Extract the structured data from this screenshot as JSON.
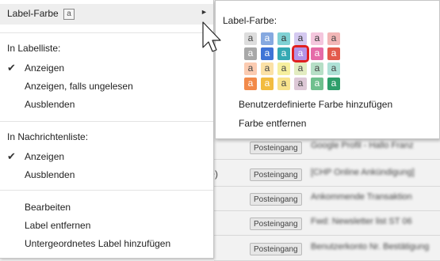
{
  "menu": {
    "label_color": {
      "label": "Label-Farbe",
      "badge": "a",
      "arrow": "►"
    },
    "in_label_list": {
      "header": "In Labelliste:",
      "items": [
        {
          "label": "Anzeigen",
          "checked": true
        },
        {
          "label": "Anzeigen, falls ungelesen",
          "checked": false
        },
        {
          "label": "Ausblenden",
          "checked": false
        }
      ]
    },
    "in_message_list": {
      "header": "In Nachrichtenliste:",
      "items": [
        {
          "label": "Anzeigen",
          "checked": true
        },
        {
          "label": "Ausblenden",
          "checked": false
        }
      ]
    },
    "actions": [
      {
        "label": "Bearbeiten"
      },
      {
        "label": "Label entfernen"
      },
      {
        "label": "Untergeordnetes Label hinzufügen"
      }
    ],
    "checkmark": "✔"
  },
  "color_submenu": {
    "title": "Label-Farbe:",
    "swatch_letter": "a",
    "grid": [
      [
        {
          "bg": "#dddddd",
          "fg": "#444444"
        },
        {
          "bg": "#86a9e0",
          "fg": "#ffffff"
        },
        {
          "bg": "#7fd1d4",
          "fg": "#333333"
        },
        {
          "bg": "#d4c9f0",
          "fg": "#333333"
        },
        {
          "bg": "#f4c6dd",
          "fg": "#333333"
        },
        {
          "bg": "#f2b6b6",
          "fg": "#444444"
        }
      ],
      [
        {
          "bg": "#a8a8a8",
          "fg": "#ffffff"
        },
        {
          "bg": "#3f74d6",
          "fg": "#ffffff"
        },
        {
          "bg": "#35a9b3",
          "fg": "#ffffff"
        },
        {
          "bg": "#b493e6",
          "fg": "#ffffff",
          "selected": true
        },
        {
          "bg": "#e56ba8",
          "fg": "#ffffff"
        },
        {
          "bg": "#e35a4c",
          "fg": "#ffffff"
        }
      ],
      [
        {
          "bg": "#fbcbb1",
          "fg": "#444444"
        },
        {
          "bg": "#fbe1a6",
          "fg": "#444444"
        },
        {
          "bg": "#f6ef9e",
          "fg": "#444444"
        },
        {
          "bg": "#e2ecc0",
          "fg": "#444444"
        },
        {
          "bg": "#b6dfc6",
          "fg": "#444444"
        },
        {
          "bg": "#aee1d6",
          "fg": "#444444"
        }
      ],
      [
        {
          "bg": "#f28a4a",
          "fg": "#ffffff"
        },
        {
          "bg": "#f2bc40",
          "fg": "#ffffff"
        },
        {
          "bg": "#f8e38c",
          "fg": "#444444"
        },
        {
          "bg": "#ddc8d6",
          "fg": "#444444"
        },
        {
          "bg": "#6fc08e",
          "fg": "#ffffff"
        },
        {
          "bg": "#2e9e6a",
          "fg": "#ffffff"
        }
      ]
    ],
    "custom_color_link": "Benutzerdefinierte Farbe hinzufügen",
    "remove_color_link": "Farbe entfernen"
  },
  "background_rows": [
    {
      "tag": "Posteingang",
      "subject": "Google Profil - Hallo Franz",
      "extra": ""
    },
    {
      "tag": "Posteingang",
      "subject": "[CHP Online Ankündigung]",
      "extra": "+)"
    },
    {
      "tag": "Posteingang",
      "subject": "Ankommende Transaktion",
      "extra": ""
    },
    {
      "tag": "Posteingang",
      "subject": "Fwd: Newsletter list ST 06",
      "extra": ""
    },
    {
      "tag": "Posteingang",
      "subject": "Benutzerkonto Nr. Bestätigung",
      "extra": ""
    }
  ]
}
